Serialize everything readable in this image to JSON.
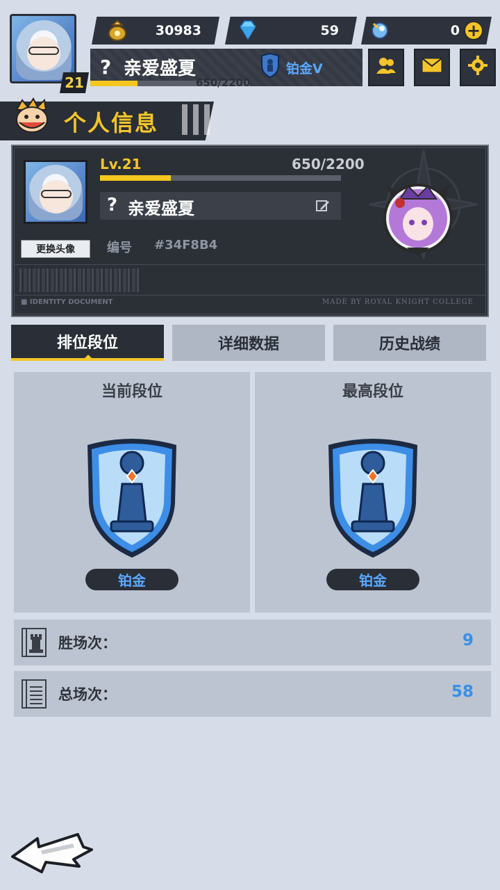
{
  "topbar": {
    "level": "21",
    "resources": [
      {
        "name": "gold",
        "icon": "coin-bag-icon",
        "value": "30983"
      },
      {
        "name": "diamond",
        "icon": "diamond-icon",
        "value": "59"
      },
      {
        "name": "gem",
        "icon": "gem-icon",
        "value": "0"
      }
    ],
    "player_name": "亲爱盛夏",
    "name_prefix": "?",
    "exp_text": "650/2200",
    "exp_fraction": 0.295,
    "rank_text": "铂金V"
  },
  "header": {
    "title": "个人信息"
  },
  "card": {
    "level_label": "Lv.21",
    "exp_text": "650/2200",
    "exp_fraction": 0.295,
    "name_prefix": "?",
    "name": "亲爱盛夏",
    "change_avatar_label": "更换头像",
    "id_label": "编号",
    "id_value": "#34F8B4",
    "identity_doc": "■ IDENTITY DOCUMENT",
    "made_by": "MADE BY ROYAL KNIGHT COLLEGE"
  },
  "tabs": [
    {
      "label": "排位段位",
      "active": true
    },
    {
      "label": "详细数据",
      "active": false
    },
    {
      "label": "历史战绩",
      "active": false
    }
  ],
  "ranks": {
    "current": {
      "title": "当前段位",
      "rank": "铂金"
    },
    "highest": {
      "title": "最高段位",
      "rank": "铂金"
    }
  },
  "stats": [
    {
      "label": "胜场次：",
      "value": "9",
      "icon": "rook-icon"
    },
    {
      "label": "总场次：",
      "value": "58",
      "icon": "notebook-icon"
    }
  ],
  "colors": {
    "accent_yellow": "#f4c52a",
    "rank_blue": "#5aa8ff",
    "stat_blue": "#3a8fe6",
    "dark_panel": "#2a2e36",
    "background": "#d7dde8"
  }
}
